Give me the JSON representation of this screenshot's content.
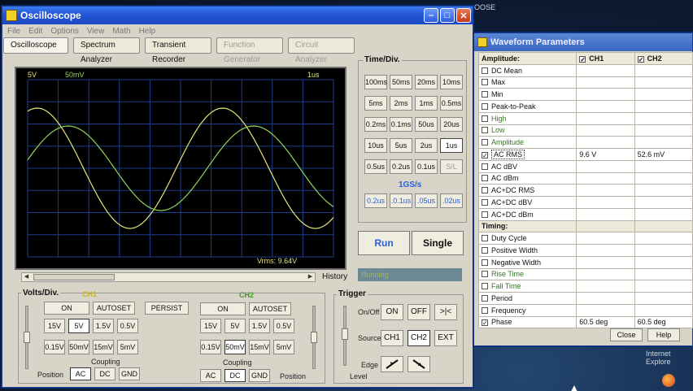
{
  "desktop": {
    "top_text": "OOSE",
    "browser_label": "Internet Explore"
  },
  "osc": {
    "title": "Oscilloscope",
    "menu": [
      "File",
      "Edit",
      "Options",
      "View",
      "Math",
      "Help"
    ],
    "tabs": [
      "Oscilloscope",
      "Spectrum Analyzer",
      "Transient Recorder",
      "Function Generator",
      "Circuit Analyzer"
    ],
    "screen": {
      "ch1_scale": "5V",
      "ch2_scale": "50mV",
      "time_scale": "1us",
      "readout": "Vrms: 9.64V"
    },
    "history_label": "History",
    "timediv": {
      "title": "Time/Div.",
      "rows": [
        [
          "100ms",
          "50ms",
          "20ms",
          "10ms"
        ],
        [
          "5ms",
          "2ms",
          "1ms",
          "0.5ms"
        ],
        [
          "0.2ms",
          "0.1ms",
          "50us",
          "20us"
        ],
        [
          "10us",
          "5us",
          "2us",
          "1us"
        ],
        [
          "0.5us",
          "0.2us",
          "0.1us",
          "S/L"
        ]
      ],
      "rate_label": "1GS/s",
      "fast_row": [
        "0.2us",
        ".0.1us",
        ".05us",
        ".02us"
      ]
    },
    "run_label": "Run",
    "single_label": "Single",
    "status_text": "Running",
    "volts": {
      "title": "Volts/Div.",
      "ch1_label": "CH1",
      "ch2_label": "CH2",
      "on_label": "ON",
      "autoset_label": "AUTOSET",
      "persist_label": "PERSIST",
      "row1": [
        "15V",
        "5V",
        "1.5V",
        "0.5V"
      ],
      "row2": [
        "0.15V",
        "50mV",
        "15mV",
        "5mV"
      ],
      "coupling_label": "Coupling",
      "coupling": [
        "AC",
        "DC",
        "GND"
      ],
      "position_label": "Position"
    },
    "trigger": {
      "title": "Trigger",
      "onoff_label": "On/Off",
      "on_label": "ON",
      "off_label": "OFF",
      "arrow_label": ">|<",
      "source_label": "Source",
      "sources": [
        "CH1",
        "CH2",
        "EXT"
      ],
      "edge_label": "Edge",
      "level_label": "Level"
    },
    "colors": {
      "ch1": "#e6e47a",
      "ch2": "#8fd65a",
      "grid": "#1e3c8c",
      "blue_text": "#2a60d6"
    }
  },
  "wp": {
    "title": "Waveform Parameters",
    "header": {
      "param": "Amplitude:",
      "ch1": "CH1",
      "ch2": "CH2"
    },
    "rows": [
      {
        "label": "DC  Mean",
        "checked": false,
        "green": false,
        "ch1": "",
        "ch2": ""
      },
      {
        "label": "Max",
        "checked": false,
        "green": false,
        "ch1": "",
        "ch2": ""
      },
      {
        "label": "Min",
        "checked": false,
        "green": false,
        "ch1": "",
        "ch2": ""
      },
      {
        "label": "Peak-to-Peak",
        "checked": false,
        "green": false,
        "ch1": "",
        "ch2": ""
      },
      {
        "label": "High",
        "checked": false,
        "green": true,
        "ch1": "",
        "ch2": ""
      },
      {
        "label": "Low",
        "checked": false,
        "green": true,
        "ch1": "",
        "ch2": ""
      },
      {
        "label": "Amplitude",
        "checked": false,
        "green": true,
        "ch1": "",
        "ch2": ""
      },
      {
        "label": "AC RMS",
        "checked": true,
        "green": false,
        "ch1": "9.6 V",
        "ch2": "52.6 mV"
      },
      {
        "label": "AC dBV",
        "checked": false,
        "green": false,
        "ch1": "",
        "ch2": ""
      },
      {
        "label": "AC dBm",
        "checked": false,
        "green": false,
        "ch1": "",
        "ch2": ""
      },
      {
        "label": "AC+DC RMS",
        "checked": false,
        "green": false,
        "ch1": "",
        "ch2": ""
      },
      {
        "label": "AC+DC dBV",
        "checked": false,
        "green": false,
        "ch1": "",
        "ch2": ""
      },
      {
        "label": "AC+DC dBm",
        "checked": false,
        "green": false,
        "ch1": "",
        "ch2": ""
      },
      {
        "label": "Timing:",
        "checked": null,
        "green": false,
        "ch1": "",
        "ch2": ""
      },
      {
        "label": "Duty Cycle",
        "checked": false,
        "green": false,
        "ch1": "",
        "ch2": ""
      },
      {
        "label": "Positive Width",
        "checked": false,
        "green": false,
        "ch1": "",
        "ch2": ""
      },
      {
        "label": "Negative Width",
        "checked": false,
        "green": false,
        "ch1": "",
        "ch2": ""
      },
      {
        "label": "Rise Time",
        "checked": false,
        "green": true,
        "ch1": "",
        "ch2": ""
      },
      {
        "label": "Fall Time",
        "checked": false,
        "green": true,
        "ch1": "",
        "ch2": ""
      },
      {
        "label": "Period",
        "checked": false,
        "green": false,
        "ch1": "",
        "ch2": ""
      },
      {
        "label": "Frequency",
        "checked": false,
        "green": false,
        "ch1": "",
        "ch2": ""
      },
      {
        "label": "Phase",
        "checked": true,
        "green": false,
        "ch1": "60.5 deg",
        "ch2": "60.5 deg"
      }
    ],
    "close_label": "Close",
    "help_label": "Help"
  }
}
